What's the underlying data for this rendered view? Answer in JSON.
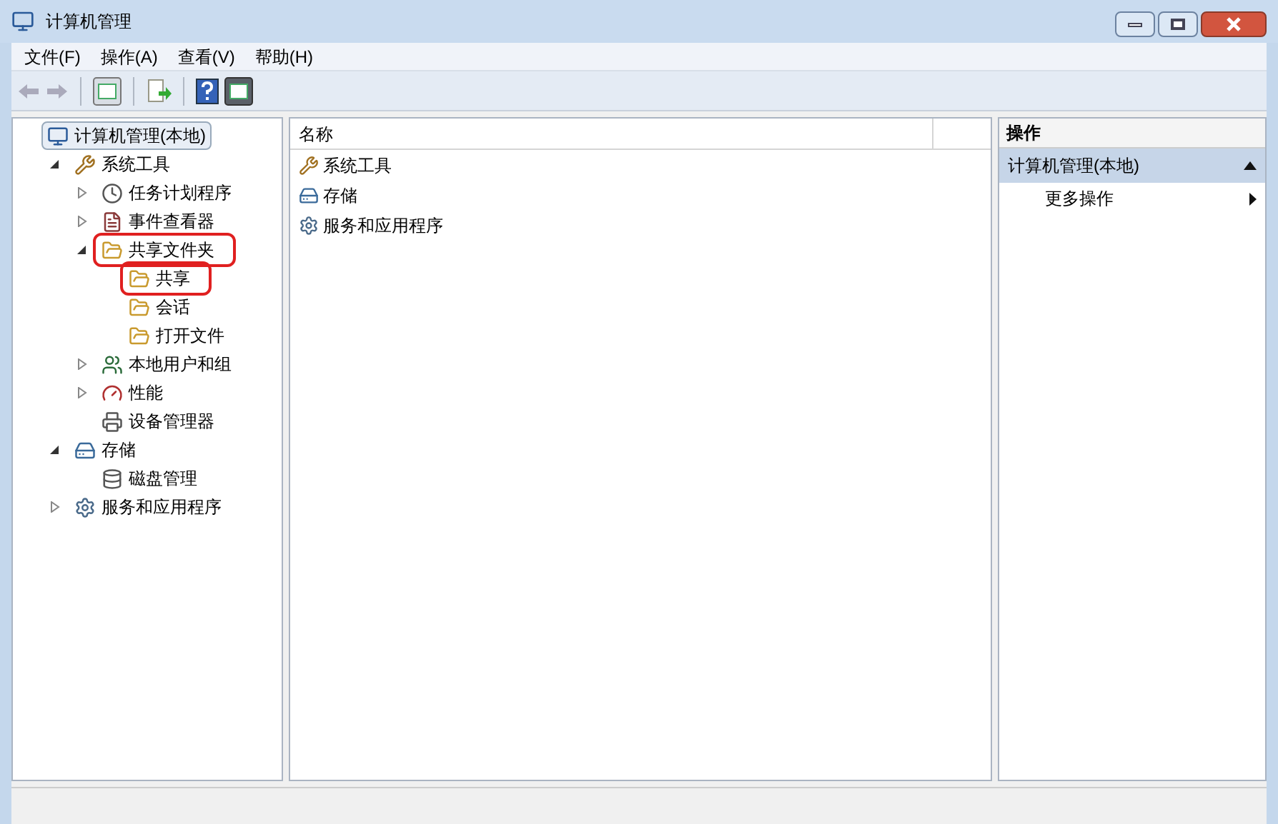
{
  "window": {
    "title": "计算机管理"
  },
  "menu": [
    "文件(F)",
    "操作(A)",
    "查看(V)",
    "帮助(H)"
  ],
  "tree": [
    {
      "label": "计算机管理(本地)",
      "selected": true,
      "highlighted": false,
      "children": [
        {
          "label": "系统工具",
          "expanded": true,
          "selected": false,
          "highlighted": false,
          "children": [
            {
              "label": "任务计划程序",
              "expanded": false,
              "selected": false,
              "highlighted": false
            },
            {
              "label": "事件查看器",
              "expanded": false,
              "selected": false,
              "highlighted": false
            },
            {
              "label": "共享文件夹",
              "expanded": true,
              "selected": false,
              "highlighted": true,
              "children": [
                {
                  "label": "共享",
                  "selected": false,
                  "highlighted": true
                },
                {
                  "label": "会话",
                  "selected": false,
                  "highlighted": false
                },
                {
                  "label": "打开文件",
                  "selected": false,
                  "highlighted": false
                }
              ]
            },
            {
              "label": "本地用户和组",
              "expanded": false,
              "selected": false,
              "highlighted": false
            },
            {
              "label": "性能",
              "expanded": false,
              "selected": false,
              "highlighted": false
            },
            {
              "label": "设备管理器",
              "selected": false,
              "highlighted": false
            }
          ]
        },
        {
          "label": "存储",
          "expanded": true,
          "selected": false,
          "highlighted": false,
          "children": [
            {
              "label": "磁盘管理",
              "selected": false,
              "highlighted": false
            }
          ]
        },
        {
          "label": "服务和应用程序",
          "expanded": false,
          "selected": false,
          "highlighted": false
        }
      ]
    }
  ],
  "list": {
    "columns": [
      "名称"
    ],
    "rows": [
      "系统工具",
      "存储",
      "服务和应用程序"
    ]
  },
  "actions": {
    "header": "操作",
    "section": "计算机管理(本地)",
    "items": [
      "更多操作"
    ]
  }
}
